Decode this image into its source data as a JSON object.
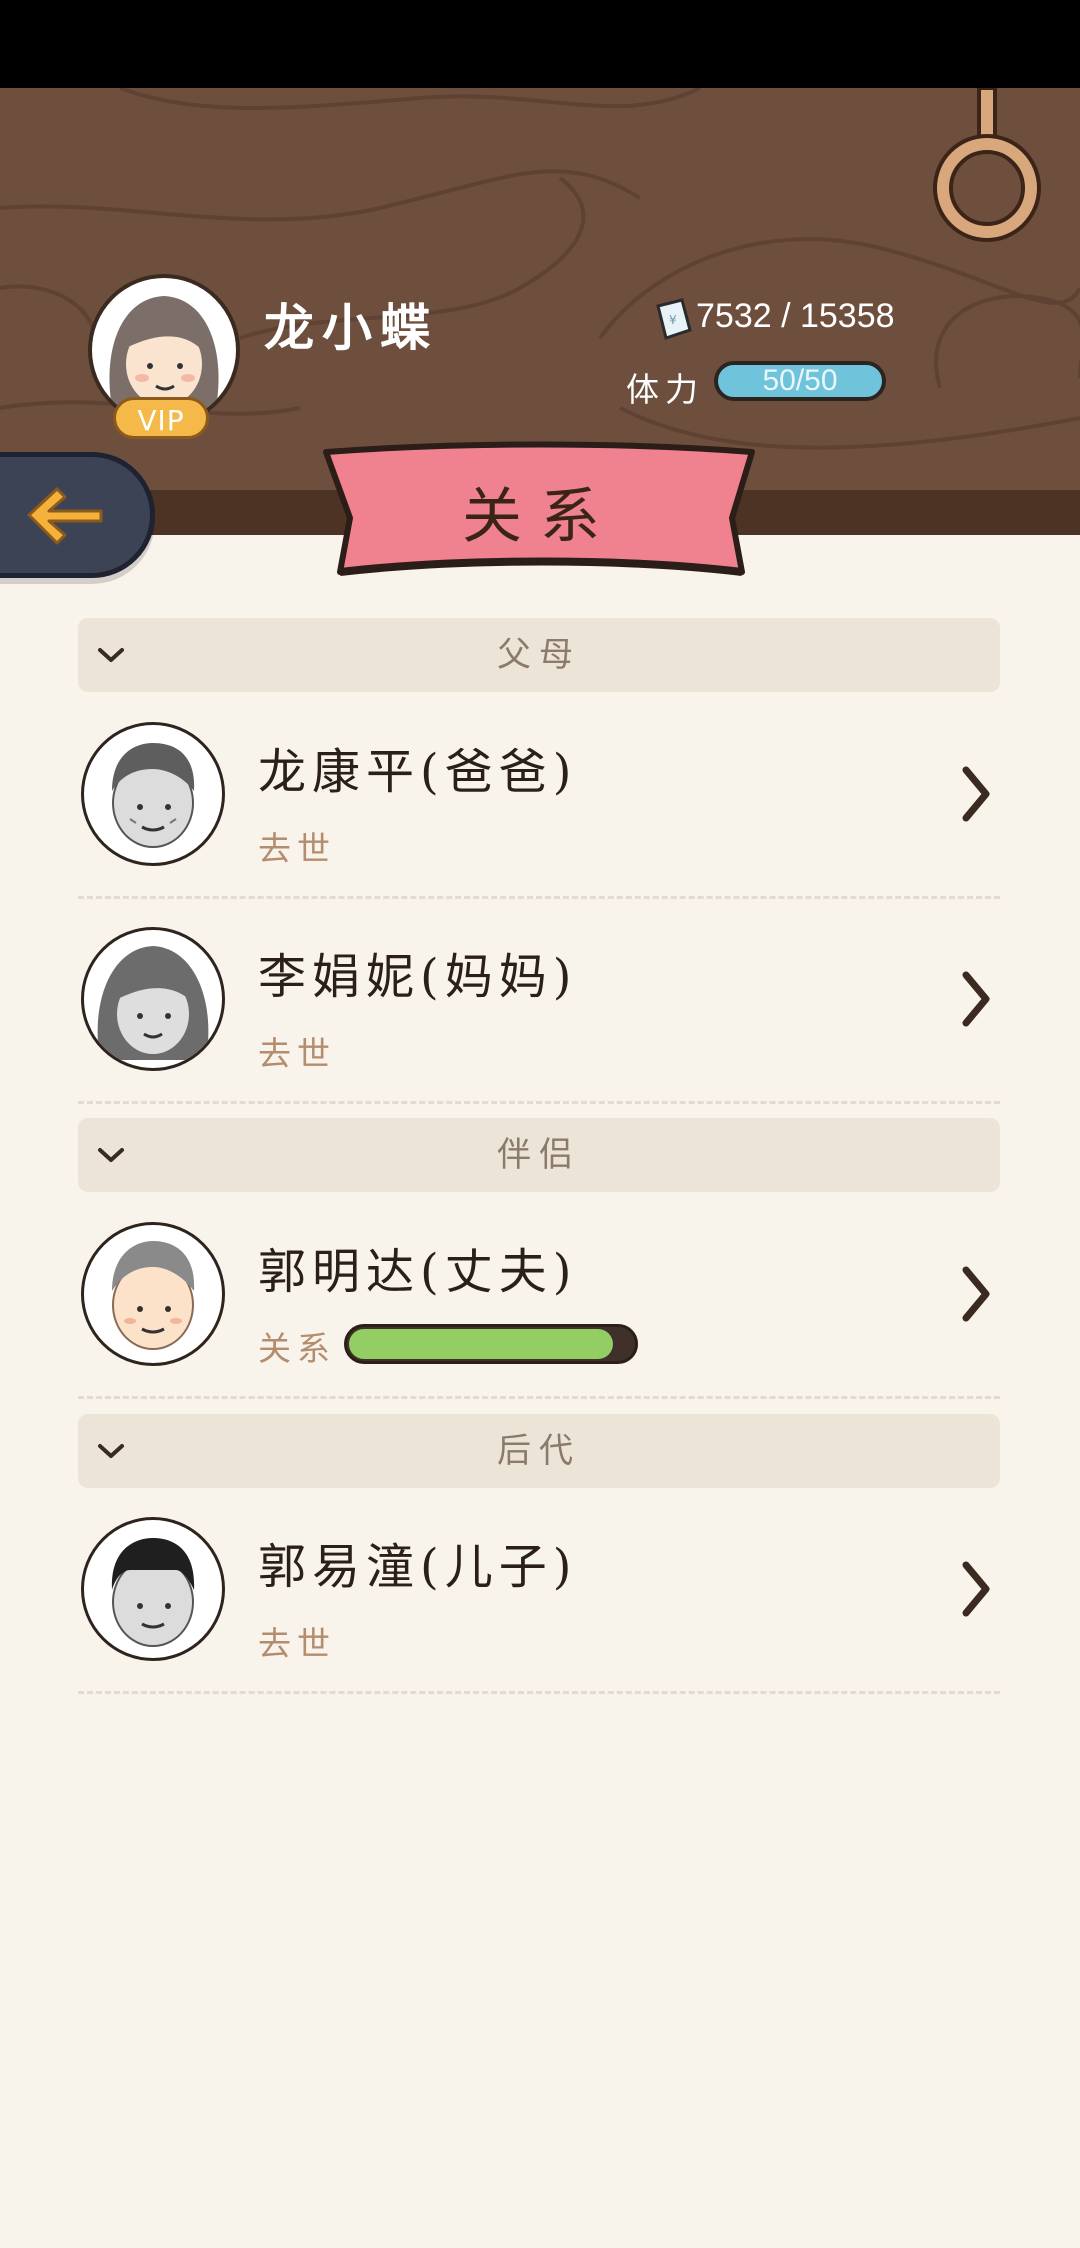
{
  "header": {
    "player_name": "龙小蝶",
    "vip_label": "VIP",
    "money": "7532 / 15358",
    "stamina_label": "体力",
    "stamina_value": "50/50"
  },
  "page_title": "关系",
  "sections": {
    "parents": {
      "label": "父母"
    },
    "partner": {
      "label": "伴侣"
    },
    "children": {
      "label": "后代"
    }
  },
  "people": {
    "father": {
      "name": "龙康平(爸爸)",
      "status": "去世"
    },
    "mother": {
      "name": "李娟妮(妈妈)",
      "status": "去世"
    },
    "husband": {
      "name": "郭明达(丈夫)",
      "relation_label": "关系",
      "relation_level": 0.93
    },
    "son": {
      "name": "郭易潼(儿子)",
      "status": "去世"
    }
  },
  "colors": {
    "wood": "#6e4f3e",
    "ribbon": "#f0828f",
    "stamina": "#6fc3da",
    "relation_fill": "#93cd63",
    "back_arrow": "#f5b23a"
  },
  "icons": [
    "ring-hook-icon",
    "money-note-icon",
    "back-arrow-icon",
    "chevron-down-icon",
    "chevron-right-icon"
  ]
}
